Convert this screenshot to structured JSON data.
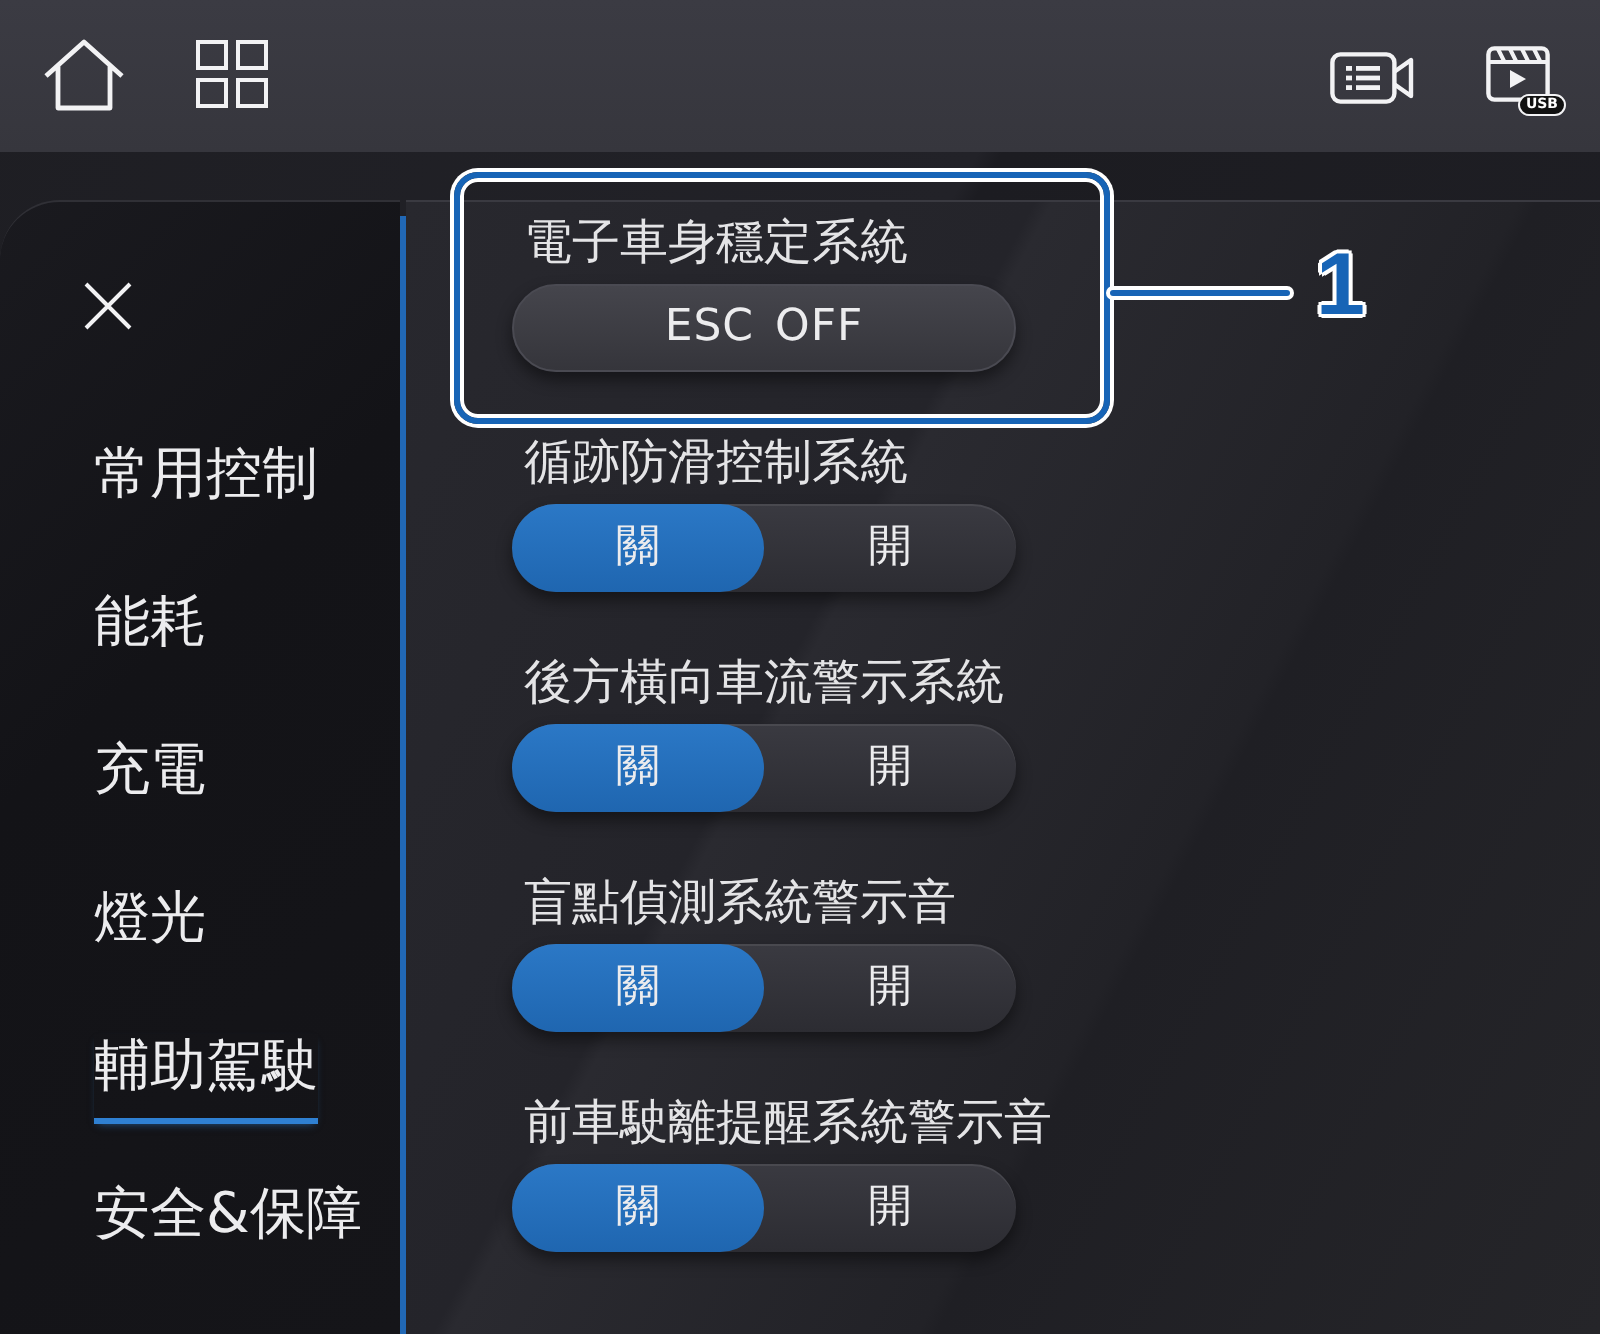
{
  "top_bar": {
    "usb_badge": "USB"
  },
  "sidebar": {
    "items": [
      {
        "label": "常用控制",
        "selected": false
      },
      {
        "label": "能耗",
        "selected": false
      },
      {
        "label": "充電",
        "selected": false
      },
      {
        "label": "燈光",
        "selected": false
      },
      {
        "label": "輔助駕駛",
        "selected": true
      },
      {
        "label": "安全&保障",
        "selected": false
      }
    ]
  },
  "settings": [
    {
      "kind": "button",
      "title": "電子車身穩定系統",
      "button": "ESC OFF",
      "callout": "1"
    },
    {
      "kind": "segmented",
      "title": "循跡防滑控制系統",
      "options": [
        {
          "label": "關",
          "selected": true
        },
        {
          "label": "開",
          "selected": false
        }
      ]
    },
    {
      "kind": "segmented",
      "title": "後方橫向車流警示系統",
      "options": [
        {
          "label": "關",
          "selected": true
        },
        {
          "label": "開",
          "selected": false
        }
      ]
    },
    {
      "kind": "segmented",
      "title": "盲點偵測系統警示音",
      "options": [
        {
          "label": "關",
          "selected": true
        },
        {
          "label": "開",
          "selected": false
        }
      ]
    },
    {
      "kind": "segmented",
      "title": "前車駛離提醒系統警示音",
      "options": [
        {
          "label": "關",
          "selected": true
        },
        {
          "label": "開",
          "selected": false
        }
      ]
    }
  ]
}
